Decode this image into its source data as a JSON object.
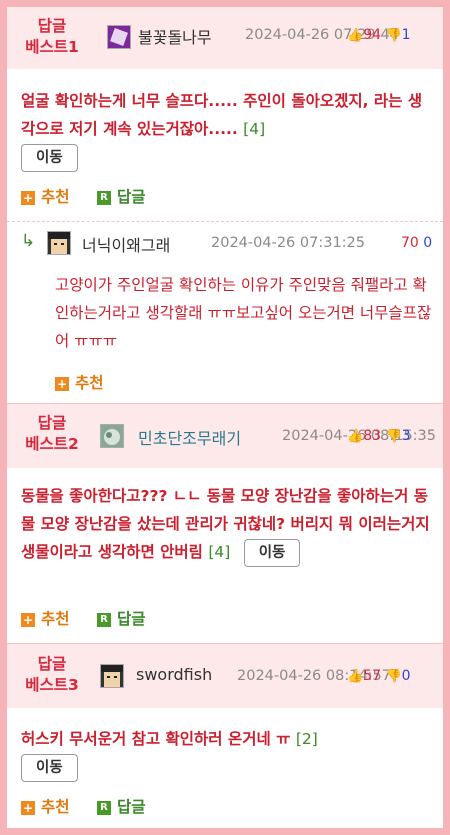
{
  "best1": {
    "rank": [
      "답글",
      "베스트1"
    ],
    "nickname": "불꽃돌나무",
    "date": "2024-04-26 07:29:44",
    "up": "94",
    "down": "1",
    "text": "얼굴 확인하는게 너무 슬프다..... 주인이 돌아오겠지, 라는 생각으로 저기 계속 있는거잖아.....",
    "count": "[4]",
    "move": "이동",
    "recommend": "추천",
    "reply": "답글"
  },
  "sub1": {
    "arrow": "↳",
    "nickname": "너닉이왜그래",
    "date": "2024-04-26 07:31:25",
    "up": "70",
    "down": "0",
    "text": "고양이가 주인얼굴 확인하는 이유가 주인맞음 줘팰라고 확인하는거라고 생각할래 ㅠㅠ보고싶어 오는거면 너무슬프잖어 ㅠㅠㅠ",
    "recommend": "추천"
  },
  "best2": {
    "rank": [
      "답글",
      "베스트2"
    ],
    "nickname": "민초단조무래기",
    "date": "2024-04-26 08:15:35",
    "up": "83",
    "down": "3",
    "text": "동물을 좋아한다고??? ㄴㄴ 동물 모양 장난감을 좋아하는거 동물 모양 장난감을 샀는데 관리가 귀찮네? 버리지 뭐 이러는거지 생물이라고 생각하면 안버림",
    "count": "[4]",
    "move": "이동",
    "recommend": "추천",
    "reply": "답글"
  },
  "best3": {
    "rank": [
      "답글",
      "베스트3"
    ],
    "nickname": "swordfish",
    "date": "2024-04-26 08:14:57",
    "up": "57",
    "down": "0",
    "text": "허스키 무서운거 참고 확인하러 온거네 ㅠ",
    "count": "[2]",
    "move": "이동",
    "recommend": "추천",
    "reply": "답글"
  },
  "colors": {
    "accent": "#d8283e",
    "downvote": "#2c4ad0",
    "count": "#3c8a2b",
    "frame": "#f7b4b8"
  }
}
